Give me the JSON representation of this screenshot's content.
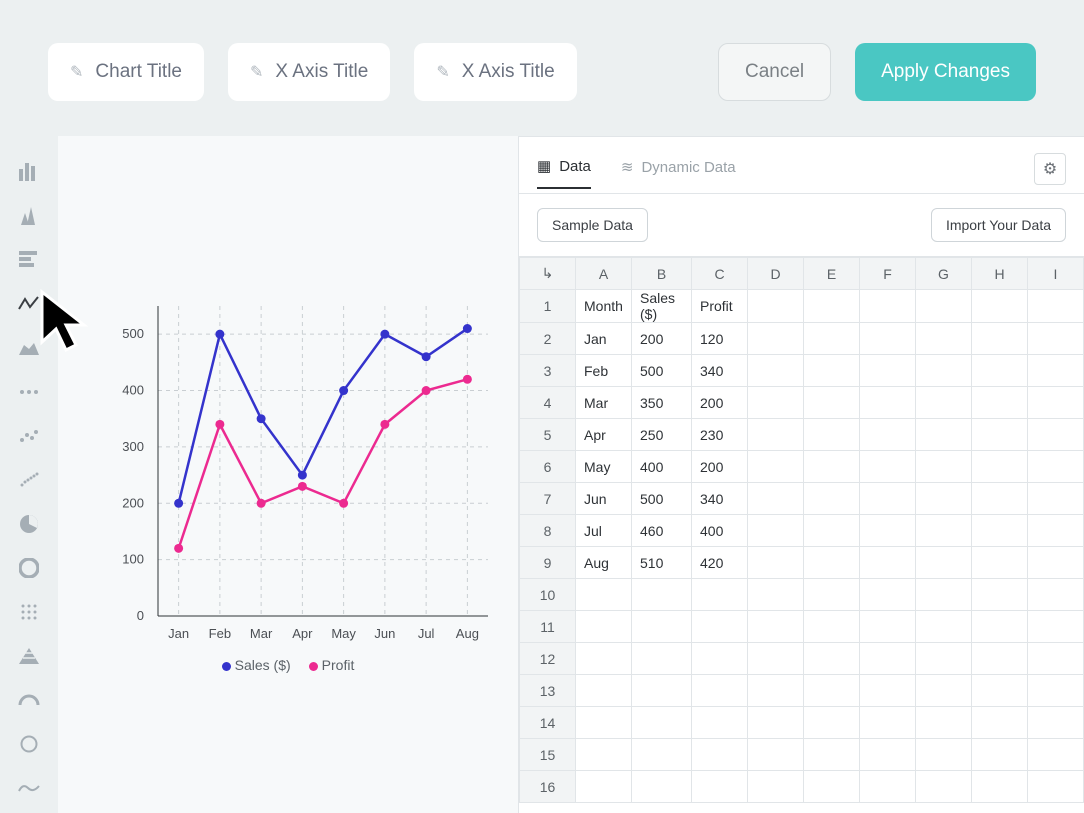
{
  "topbar": {
    "chart_title_placeholder": "Chart Title",
    "x_axis_placeholder": "X Axis Title",
    "y_axis_placeholder": "X Axis Title",
    "cancel_label": "Cancel",
    "apply_label": "Apply Changes"
  },
  "sidebar": {
    "items": [
      {
        "name": "bar-chart-icon"
      },
      {
        "name": "column-chart-icon"
      },
      {
        "name": "horizontal-bar-icon"
      },
      {
        "name": "line-chart-icon",
        "active": true
      },
      {
        "name": "area-chart-icon"
      },
      {
        "name": "dots-1-icon"
      },
      {
        "name": "dots-2-icon"
      },
      {
        "name": "dots-3-icon"
      },
      {
        "name": "pie-chart-icon"
      },
      {
        "name": "donut-chart-icon"
      },
      {
        "name": "grid-icon"
      },
      {
        "name": "pyramid-icon"
      },
      {
        "name": "gauge-icon"
      },
      {
        "name": "circle-icon"
      },
      {
        "name": "wave-icon"
      }
    ]
  },
  "tabs": {
    "data_label": "Data",
    "dynamic_label": "Dynamic Data"
  },
  "data_toolbar": {
    "sample_label": "Sample Data",
    "import_label": "Import Your Data"
  },
  "spreadsheet": {
    "cols": [
      "A",
      "B",
      "C",
      "D",
      "E",
      "F",
      "G",
      "H",
      "I"
    ],
    "rows": [
      [
        "Month",
        "Sales ($)",
        "Profit",
        "",
        "",
        "",
        "",
        "",
        ""
      ],
      [
        "Jan",
        "200",
        "120",
        "",
        "",
        "",
        "",
        "",
        ""
      ],
      [
        "Feb",
        "500",
        "340",
        "",
        "",
        "",
        "",
        "",
        ""
      ],
      [
        "Mar",
        "350",
        "200",
        "",
        "",
        "",
        "",
        "",
        ""
      ],
      [
        "Apr",
        "250",
        "230",
        "",
        "",
        "",
        "",
        "",
        ""
      ],
      [
        "May",
        "400",
        "200",
        "",
        "",
        "",
        "",
        "",
        ""
      ],
      [
        "Jun",
        "500",
        "340",
        "",
        "",
        "",
        "",
        "",
        ""
      ],
      [
        "Jul",
        "460",
        "400",
        "",
        "",
        "",
        "",
        "",
        ""
      ],
      [
        "Aug",
        "510",
        "420",
        "",
        "",
        "",
        "",
        "",
        ""
      ],
      [
        "",
        "",
        "",
        "",
        "",
        "",
        "",
        "",
        ""
      ],
      [
        "",
        "",
        "",
        "",
        "",
        "",
        "",
        "",
        ""
      ],
      [
        "",
        "",
        "",
        "",
        "",
        "",
        "",
        "",
        ""
      ],
      [
        "",
        "",
        "",
        "",
        "",
        "",
        "",
        "",
        ""
      ],
      [
        "",
        "",
        "",
        "",
        "",
        "",
        "",
        "",
        ""
      ],
      [
        "",
        "",
        "",
        "",
        "",
        "",
        "",
        "",
        ""
      ],
      [
        "",
        "",
        "",
        "",
        "",
        "",
        "",
        "",
        ""
      ]
    ]
  },
  "legend": {
    "series1": "Sales ($)",
    "series2": "Profit"
  },
  "chart_data": {
    "type": "line",
    "categories": [
      "Jan",
      "Feb",
      "Mar",
      "Apr",
      "May",
      "Jun",
      "Jul",
      "Aug"
    ],
    "series": [
      {
        "name": "Sales ($)",
        "color": "#3433cc",
        "values": [
          200,
          500,
          350,
          250,
          400,
          500,
          460,
          510
        ]
      },
      {
        "name": "Profit",
        "color": "#ec2a90",
        "values": [
          120,
          340,
          200,
          230,
          200,
          340,
          400,
          420
        ]
      }
    ],
    "title": "",
    "xlabel": "",
    "ylabel": "",
    "ylim": [
      0,
      550
    ],
    "yticks": [
      0,
      100,
      200,
      300,
      400,
      500
    ]
  },
  "colors": {
    "accent": "#4ac7c3",
    "series1": "#3433cc",
    "series2": "#ec2a90"
  }
}
